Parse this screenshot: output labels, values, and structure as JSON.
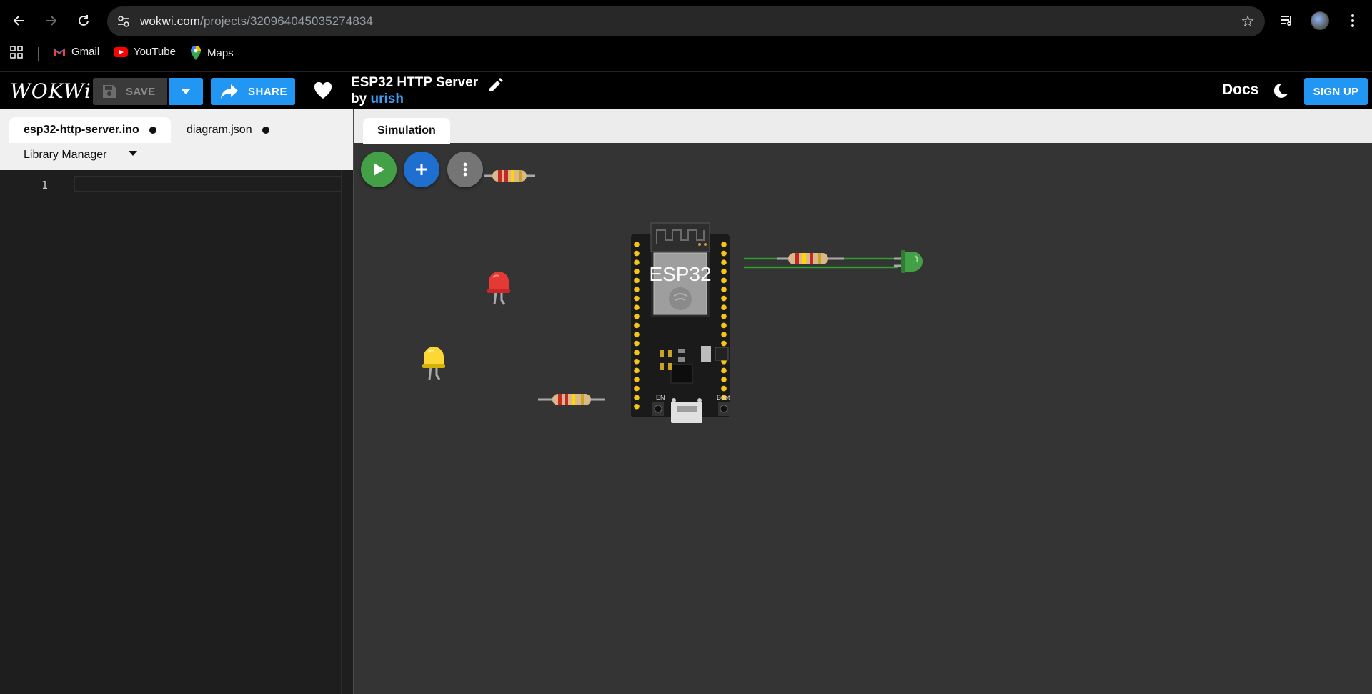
{
  "browser": {
    "url_host": "wokwi.com",
    "url_path": "/projects/320964045035274834",
    "bookmarks": [
      {
        "label": "Gmail",
        "icon": "gmail-icon"
      },
      {
        "label": "YouTube",
        "icon": "youtube-icon"
      },
      {
        "label": "Maps",
        "icon": "maps-icon"
      }
    ]
  },
  "header": {
    "logo": "WOKWi",
    "save_label": "SAVE",
    "share_label": "SHARE",
    "project_title": "ESP32 HTTP Server",
    "by_label": "by",
    "author": "urish",
    "docs_label": "Docs",
    "signup_label": "SIGN UP"
  },
  "editor": {
    "tabs": [
      {
        "label": "esp32-http-server.ino",
        "active": true,
        "modified": true
      },
      {
        "label": "diagram.json",
        "active": false,
        "modified": true
      }
    ],
    "library_manager_label": "Library Manager",
    "line_numbers": [
      "1"
    ]
  },
  "simulation": {
    "tab_label": "Simulation",
    "board_label": "ESP32",
    "en_label": "EN",
    "boot_label": "Boot",
    "colors": {
      "start_button": "#43a047",
      "add_button": "#1e6fd0",
      "more_button": "#757575",
      "led_red": "#e53935",
      "led_yellow": "#fdd835",
      "led_green": "#43a047",
      "wire": "#2e9e2e",
      "board": "#1a1a1a"
    }
  }
}
